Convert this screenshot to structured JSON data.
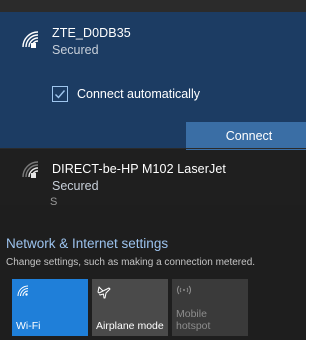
{
  "selected_network": {
    "name": "ZTE_D0DB35",
    "status": "Secured",
    "connect_automatically_label": "Connect automatically",
    "connect_automatically_checked": true,
    "connect_button": "Connect",
    "icon": "wifi-secured-icon"
  },
  "networks": [
    {
      "name": "DIRECT-be-HP M102 LaserJet",
      "status": "Secured",
      "icon": "wifi-secured-icon"
    }
  ],
  "partial_network_peek": "S",
  "settings": {
    "title": "Network & Internet settings",
    "subtitle": "Change settings, such as making a connection metered."
  },
  "quick_actions": [
    {
      "label": "Wi-Fi",
      "icon": "wifi-icon",
      "state": "on"
    },
    {
      "label": "Airplane mode",
      "icon": "airplane-icon",
      "state": "off"
    },
    {
      "label_line1": "Mobile",
      "label_line2": "hotspot",
      "icon": "hotspot-icon",
      "state": "disabled"
    }
  ],
  "colors": {
    "panel_bg": "#1f1f1f",
    "selected_bg": "#1c3c63",
    "accent": "#1f7fd9",
    "connect_button_bg": "#3a6ea5",
    "link_text": "#9cc3ee"
  }
}
